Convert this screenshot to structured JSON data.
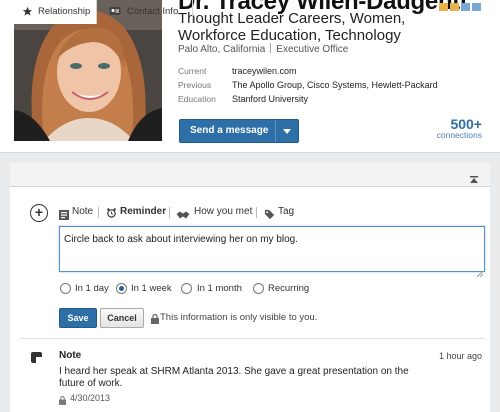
{
  "profile": {
    "name": "Dr. Tracey Wilen-Daugenti",
    "headline": "Thought Leader Careers, Women, Workforce Education, Technology",
    "location": "Palo Alto, California",
    "industry": "Executive Office",
    "details": [
      {
        "label": "Current",
        "value": "traceywilen.com"
      },
      {
        "label": "Previous",
        "value": "The Apollo Group, Cisco Systems, Hewlett-Packard"
      },
      {
        "label": "Education",
        "value": "Stanford University"
      }
    ],
    "send_message_label": "Send a message",
    "connections_count": "500+",
    "connections_label": "connections"
  },
  "tabs": [
    {
      "label": "Relationship",
      "icon": "star-icon"
    },
    {
      "label": "Contact Info",
      "icon": "address-card-icon"
    }
  ],
  "actions": [
    {
      "label": "Note",
      "icon": "note-icon"
    },
    {
      "label": "Reminder",
      "icon": "alarm-clock-icon"
    },
    {
      "label": "How you met",
      "icon": "handshake-icon"
    },
    {
      "label": "Tag",
      "icon": "tag-icon"
    }
  ],
  "reminder": {
    "text": "Circle back to ask about interviewing her on my blog.",
    "options": [
      "In 1 day",
      "In 1 week",
      "In 1 month",
      "Recurring"
    ],
    "selected": "In 1 week",
    "save_label": "Save",
    "cancel_label": "Cancel",
    "privacy_text": "This information is only visible to you."
  },
  "note": {
    "title": "Note",
    "time": "1 hour ago",
    "body": "I heard her speak at SHRM Atlanta 2013. She gave a great presentation on the future of work.",
    "date": "4/30/2013"
  },
  "colors": {
    "linkedin_blue": "#2e6fa8",
    "panel_bg": "#e9ebec"
  }
}
